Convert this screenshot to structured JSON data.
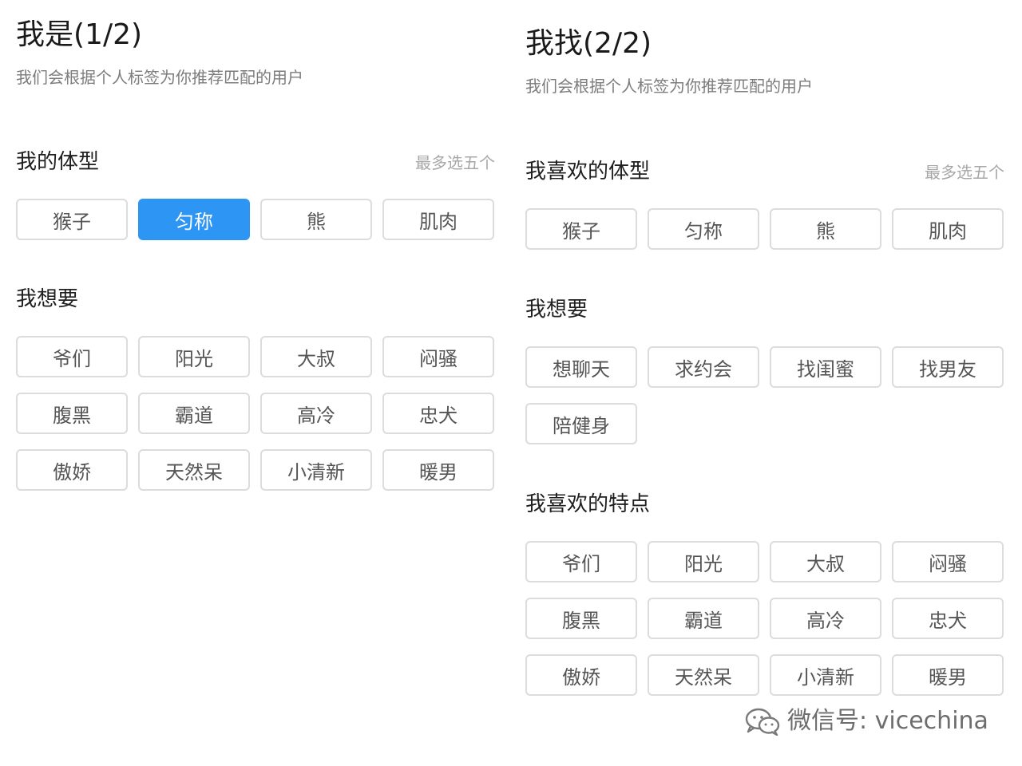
{
  "left": {
    "title": "我是(1/2)",
    "subtitle": "我们会根据个人标签为你推荐匹配的用户",
    "body_type": {
      "title": "我的体型",
      "hint": "最多选五个",
      "options": [
        {
          "label": "猴子",
          "selected": false
        },
        {
          "label": "匀称",
          "selected": true
        },
        {
          "label": "熊",
          "selected": false
        },
        {
          "label": "肌肉",
          "selected": false
        }
      ]
    },
    "want": {
      "title": "我想要",
      "options": [
        {
          "label": "爷们"
        },
        {
          "label": "阳光"
        },
        {
          "label": "大叔"
        },
        {
          "label": "闷骚"
        },
        {
          "label": "腹黑"
        },
        {
          "label": "霸道"
        },
        {
          "label": "高冷"
        },
        {
          "label": "忠犬"
        },
        {
          "label": "傲娇"
        },
        {
          "label": "天然呆"
        },
        {
          "label": "小清新"
        },
        {
          "label": "暖男"
        }
      ]
    }
  },
  "right": {
    "title": "我找(2/2)",
    "subtitle": "我们会根据个人标签为你推荐匹配的用户",
    "body_type": {
      "title": "我喜欢的体型",
      "hint": "最多选五个",
      "options": [
        {
          "label": "猴子"
        },
        {
          "label": "匀称"
        },
        {
          "label": "熊"
        },
        {
          "label": "肌肉"
        }
      ]
    },
    "want": {
      "title": "我想要",
      "options": [
        {
          "label": "想聊天"
        },
        {
          "label": "求约会"
        },
        {
          "label": "找闺蜜"
        },
        {
          "label": "找男友"
        },
        {
          "label": "陪健身"
        }
      ]
    },
    "traits": {
      "title": "我喜欢的特点",
      "options": [
        {
          "label": "爷们"
        },
        {
          "label": "阳光"
        },
        {
          "label": "大叔"
        },
        {
          "label": "闷骚"
        },
        {
          "label": "腹黑"
        },
        {
          "label": "霸道"
        },
        {
          "label": "高冷"
        },
        {
          "label": "忠犬"
        },
        {
          "label": "傲娇"
        },
        {
          "label": "天然呆"
        },
        {
          "label": "小清新"
        },
        {
          "label": "暖男"
        }
      ]
    }
  },
  "watermark": {
    "icon": "wechat-icon",
    "text": "微信号: vicechina"
  },
  "colors": {
    "accent": "#2d95f3",
    "chip_border": "#dcdcdc",
    "chip_text": "#555555",
    "hint_text": "#a7a7a7"
  }
}
